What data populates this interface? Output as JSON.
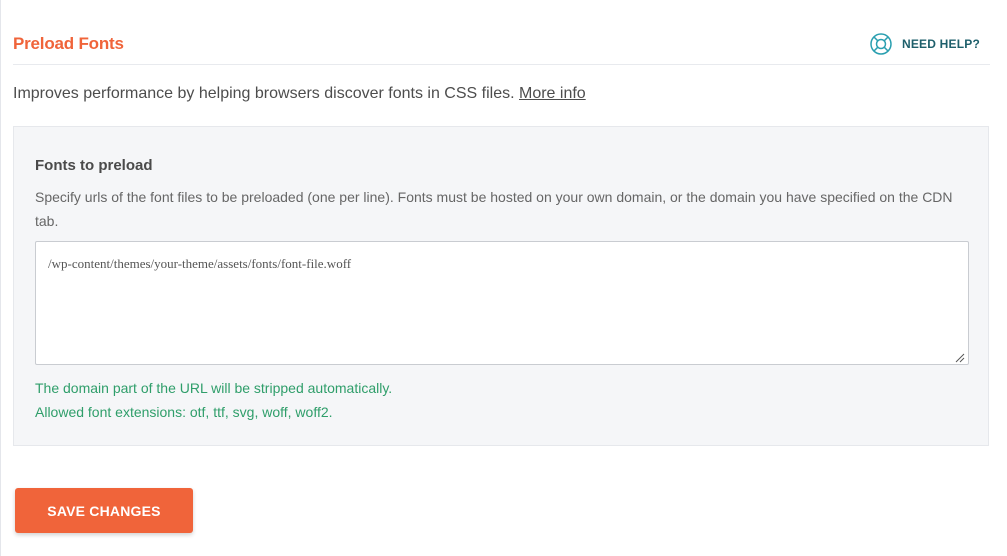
{
  "section": {
    "title": "Preload Fonts",
    "help_label": "NEED HELP?",
    "description": "Improves performance by helping browsers discover fonts in CSS files.",
    "more_info_label": "More info"
  },
  "field": {
    "title": "Fonts to preload",
    "help_text": "Specify urls of the font files to be preloaded (one per line). Fonts must be hosted on your own domain, or the domain you have specified on the CDN tab.",
    "value": "/wp-content/themes/your-theme/assets/fonts/font-file.woff",
    "note_1": "The domain part of the URL will be stripped automatically.",
    "note_2": "Allowed font extensions: otf, ttf, svg, woff, woff2."
  },
  "actions": {
    "save_label": "SAVE CHANGES"
  },
  "icons": {
    "help": "lifebuoy-icon",
    "resize": "resize-grip-icon"
  },
  "colors": {
    "accent": "#f0643a",
    "help_text": "#1e5f6b",
    "note_text": "#2f9e6a",
    "panel_bg": "#f5f6f8"
  }
}
